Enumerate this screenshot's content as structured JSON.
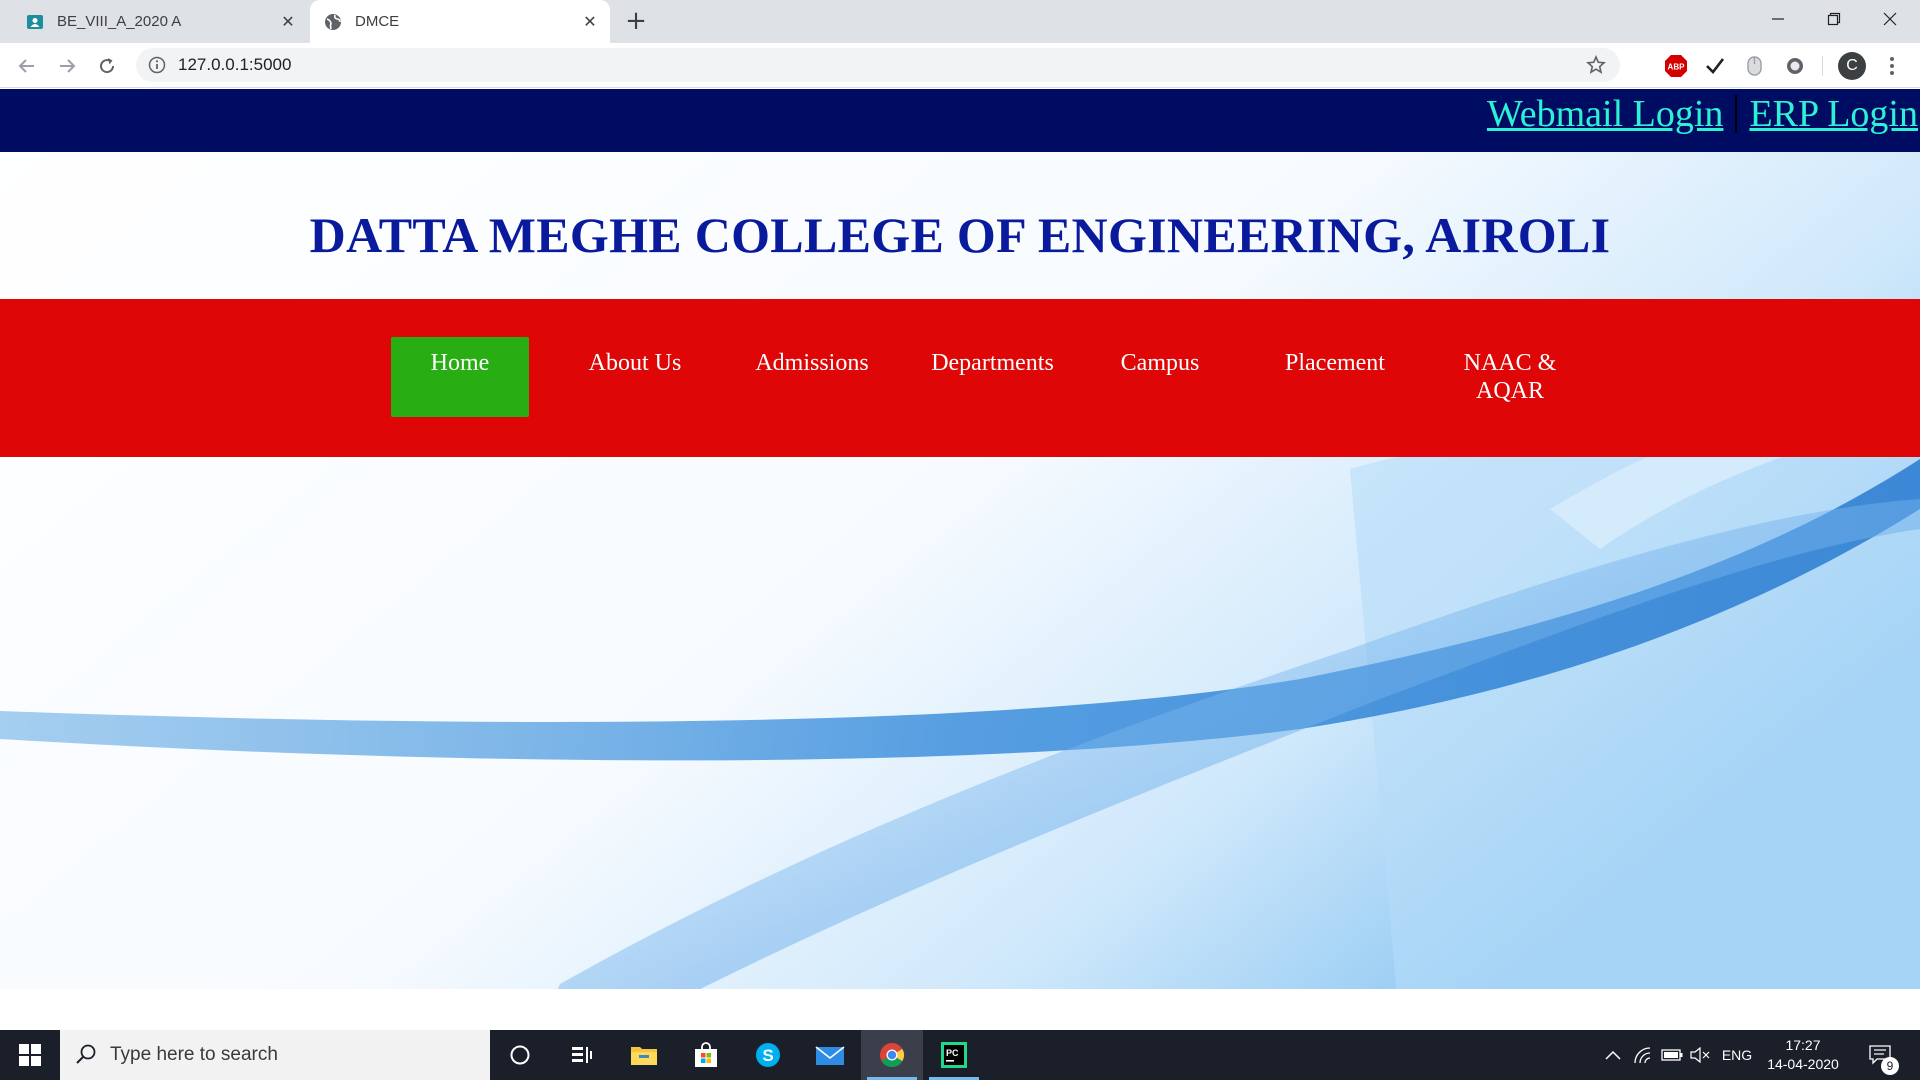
{
  "browser": {
    "tabs": [
      {
        "title": "BE_VIII_A_2020 A",
        "favicon": "classroom-icon",
        "active": false
      },
      {
        "title": "DMCE",
        "favicon": "globe-icon",
        "active": true
      }
    ],
    "url": "127.0.0.1:5000",
    "extensions": [
      "adblock-icon",
      "checkmark-icon",
      "mouse-icon",
      "circle-extension-icon"
    ],
    "profile_initial": "C"
  },
  "page": {
    "top_links": [
      "Webmail Login",
      "ERP Login"
    ],
    "college_title": "DATTA MEGHE COLLEGE OF ENGINEERING, AIROLI",
    "nav": {
      "items": [
        "Home",
        "About Us",
        "Admissions",
        "Departments",
        "Campus",
        "Placement",
        "NAAC & AQAR"
      ],
      "active": "Home"
    },
    "colors": {
      "topbar": "#000c62",
      "top_link": "#2ef0d5",
      "title": "#0a1a9c",
      "navbar": "#de0606",
      "nav_active": "#28ae12"
    }
  },
  "taskbar": {
    "search_placeholder": "Type here to search",
    "apps": [
      "cortana-icon",
      "task-view-icon",
      "file-explorer-icon",
      "store-icon",
      "skype-icon",
      "mail-icon",
      "chrome-icon",
      "pycharm-icon"
    ],
    "tray": {
      "language": "ENG",
      "time": "17:27",
      "date": "14-04-2020",
      "notifications": "9"
    }
  }
}
